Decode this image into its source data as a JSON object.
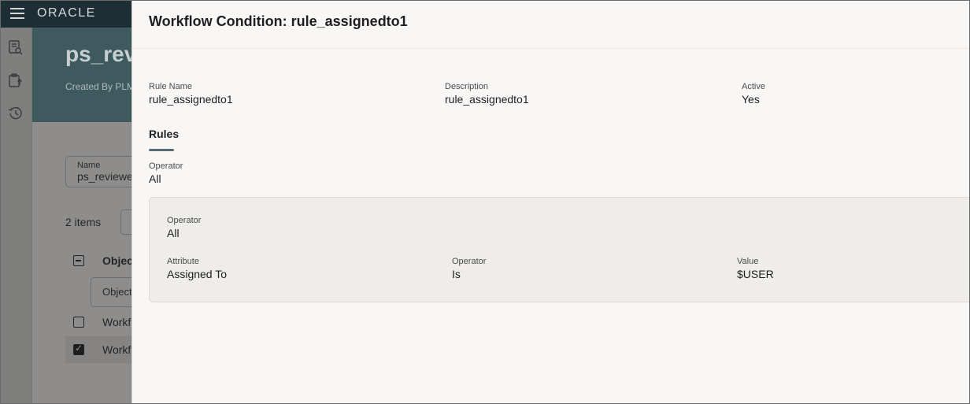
{
  "app": {
    "brand": "ORACLE"
  },
  "background_page": {
    "title": "ps_revi",
    "created_by": "Created By PLM",
    "name_field": {
      "label": "Name",
      "value": "ps_reviewe"
    },
    "items_count": "2 items",
    "table": {
      "header_label": "Objec",
      "filter_placeholder": "Object",
      "rows": [
        {
          "label": "Workf",
          "checked": false
        },
        {
          "label": "Workf",
          "checked": true
        }
      ]
    }
  },
  "drawer": {
    "title": "Workflow Condition: rule_assignedto1",
    "fields": {
      "rule_name": {
        "label": "Rule Name",
        "value": "rule_assignedto1"
      },
      "description": {
        "label": "Description",
        "value": "rule_assignedto1"
      },
      "active": {
        "label": "Active",
        "value": "Yes"
      }
    },
    "rules": {
      "section_title": "Rules",
      "operator": {
        "label": "Operator",
        "value": "All"
      },
      "group": {
        "operator": {
          "label": "Operator",
          "value": "All"
        },
        "condition": {
          "attribute": {
            "label": "Attribute",
            "value": "Assigned To"
          },
          "operator": {
            "label": "Operator",
            "value": "Is"
          },
          "value": {
            "label": "Value",
            "value": "$USER"
          }
        }
      }
    }
  }
}
